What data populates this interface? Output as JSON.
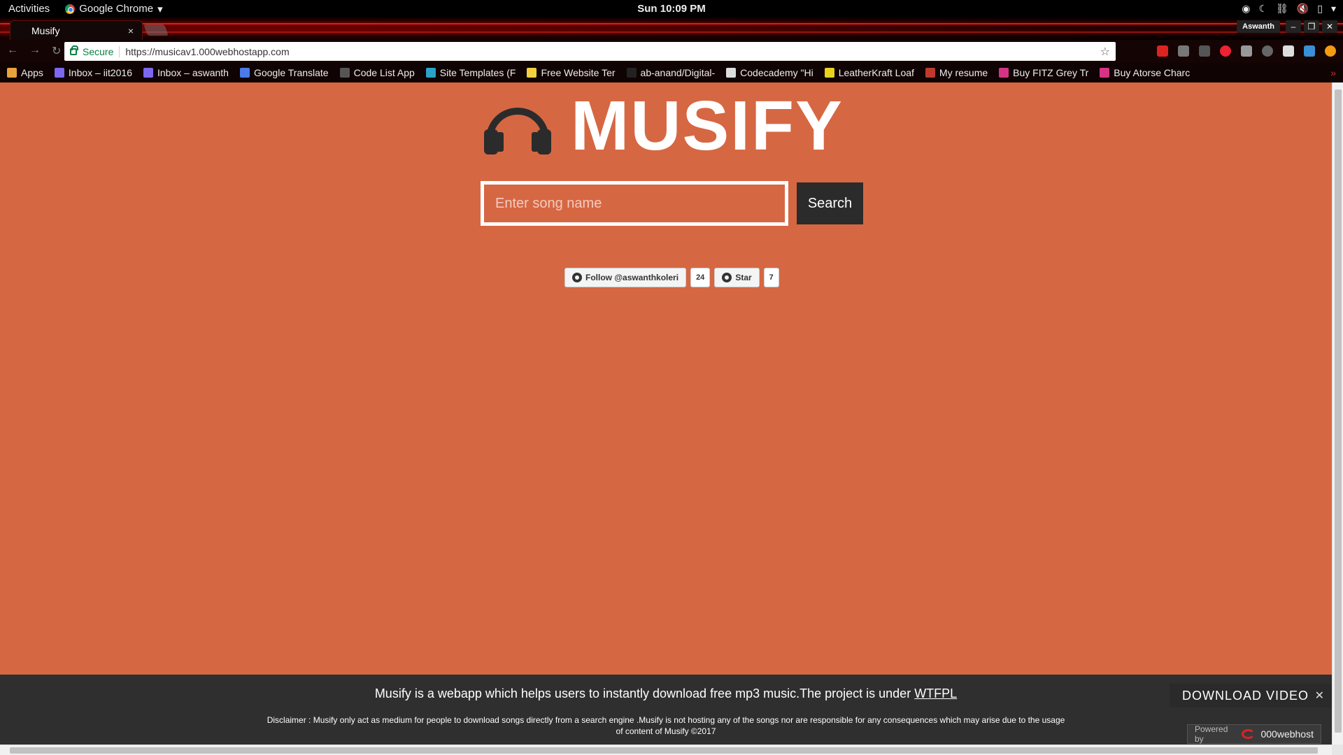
{
  "system": {
    "activities_label": "Activities",
    "app_name": "Google Chrome",
    "clock": "Sun 10:09 PM"
  },
  "browser": {
    "tab_title": "Musify",
    "tab_close": "×",
    "profile_name": "Aswanth",
    "secure_label": "Secure",
    "url": "https://musicav1.000webhostapp.com",
    "bookmarks": [
      {
        "label": "Apps",
        "color": "#e8a33b",
        "icon": "apps-grid-icon"
      },
      {
        "label": "Inbox – iit2016",
        "color": "#7b68ee",
        "icon": "inbox-icon"
      },
      {
        "label": "Inbox – aswanth",
        "color": "#7b68ee",
        "icon": "inbox-icon"
      },
      {
        "label": "Google Translate",
        "color": "#4a7be8",
        "icon": "translate-icon"
      },
      {
        "label": "Code List App",
        "color": "#555555",
        "icon": "code-icon"
      },
      {
        "label": "Site Templates (F",
        "color": "#2aa3c9",
        "icon": "template-icon"
      },
      {
        "label": "Free Website Ter",
        "color": "#f4d03f",
        "icon": "website-icon"
      },
      {
        "label": "ab-anand/Digital-",
        "color": "#222222",
        "icon": "github-icon"
      },
      {
        "label": "Codecademy \"Hi",
        "color": "#dddddd",
        "icon": "codecademy-icon"
      },
      {
        "label": "LeatherKraft Loaf",
        "color": "#e8d21d",
        "icon": "leatherkraft-icon"
      },
      {
        "label": "My resume",
        "color": "#c0392b",
        "icon": "document-icon"
      },
      {
        "label": "Buy FITZ Grey Tr",
        "color": "#d63384",
        "icon": "myntra-icon"
      },
      {
        "label": "Buy Atorse Charc",
        "color": "#d63384",
        "icon": "myntra-icon"
      }
    ]
  },
  "page": {
    "brand": "MUSIFY",
    "search_placeholder": "Enter song name",
    "search_button": "Search",
    "github": {
      "follow_label": "Follow @aswanthkoleri",
      "follow_count": "24",
      "star_label": "Star",
      "star_count": "7"
    },
    "footer": {
      "about_text": "Musify is a webapp which helps users to instantly download free mp3 music.The project is under ",
      "license_link": "WTFPL",
      "disclaimer": "Disclaimer : Musify only act as medium for people to download songs directly from a search engine .Musify is not hosting any of the songs nor are responsible for any consequences which may arise due to the usage of content of Musify ©2017"
    },
    "download_video": "DOWNLOAD VIDEO",
    "powered_by": "Powered by",
    "host_brand": "000webhost"
  },
  "colors": {
    "page_bg": "#d66743",
    "footer_bg": "#2f2f2f",
    "button_bg": "#2b2b2b"
  }
}
